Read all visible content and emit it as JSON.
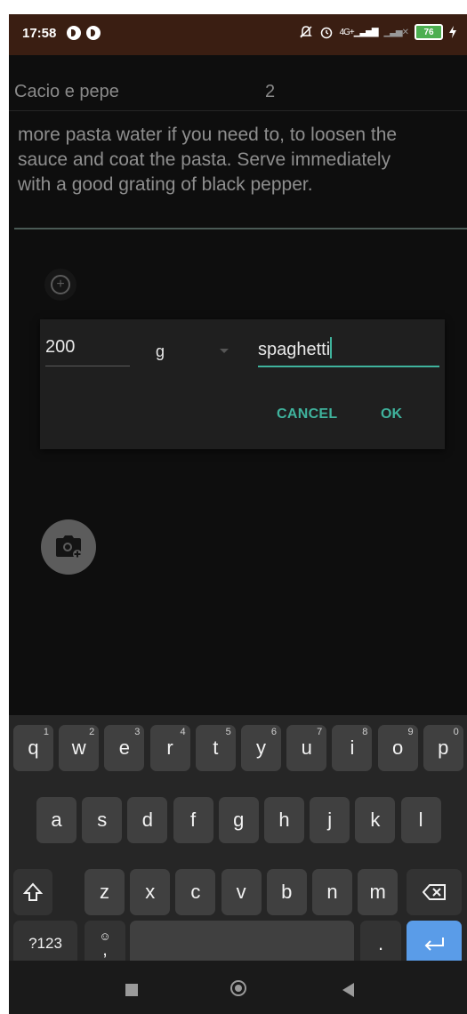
{
  "status_bar": {
    "time": "17:58",
    "network": "4G+",
    "battery": "76"
  },
  "recipe": {
    "name": "Cacio e pepe",
    "servings": "2",
    "instructions": [
      "more pasta water if you need to, to loosen the",
      "sauce and coat the pasta. Serve immediately",
      "with a good grating of black pepper."
    ]
  },
  "dialog": {
    "quantity": "200",
    "unit": "g",
    "ingredient": "spaghetti",
    "cancel_label": "CANCEL",
    "ok_label": "OK"
  },
  "keyboard": {
    "row1": [
      {
        "key": "q",
        "hint": "1"
      },
      {
        "key": "w",
        "hint": "2"
      },
      {
        "key": "e",
        "hint": "3"
      },
      {
        "key": "r",
        "hint": "4"
      },
      {
        "key": "t",
        "hint": "5"
      },
      {
        "key": "y",
        "hint": "6"
      },
      {
        "key": "u",
        "hint": "7"
      },
      {
        "key": "i",
        "hint": "8"
      },
      {
        "key": "o",
        "hint": "9"
      },
      {
        "key": "p",
        "hint": "0"
      }
    ],
    "row2": [
      "a",
      "s",
      "d",
      "f",
      "g",
      "h",
      "j",
      "k",
      "l"
    ],
    "row3": [
      "z",
      "x",
      "c",
      "v",
      "b",
      "n",
      "m"
    ],
    "symbols_label": "?123",
    "comma_label": ",",
    "period_label": "."
  },
  "colors": {
    "accent": "#3fb39d",
    "status_bar": "#3a1e12",
    "background": "#0e0e0e",
    "enter_key": "#5a9ce8"
  }
}
